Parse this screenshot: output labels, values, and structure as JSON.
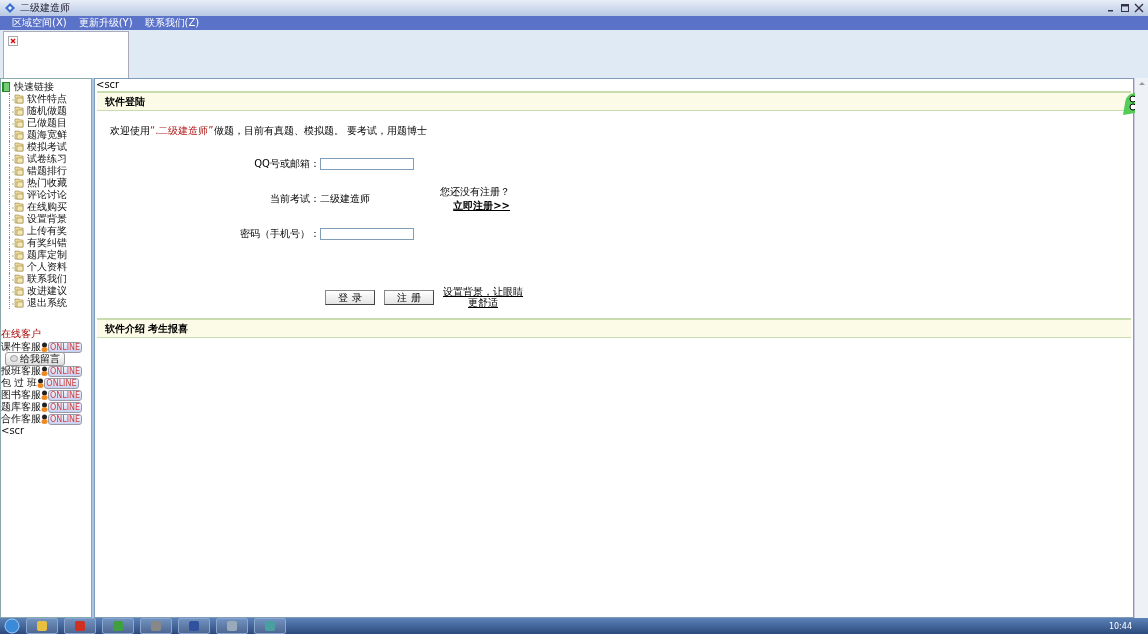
{
  "window": {
    "title": "二级建造师"
  },
  "menu": [
    "区域空间(X)",
    "更新升级(Y)",
    "联系我们(Z)"
  ],
  "frame_text_top": "<scr",
  "sidebar": {
    "root": "快速链接",
    "children": [
      {
        "label": "软件特点"
      },
      {
        "label": "随机做题"
      },
      {
        "label": "已做题目"
      },
      {
        "label": "题海宽鲜"
      },
      {
        "label": "模拟考试"
      },
      {
        "label": "试卷练习"
      },
      {
        "label": "错题排行"
      },
      {
        "label": "热门收藏"
      },
      {
        "label": "评论讨论"
      },
      {
        "label": "在线购买"
      },
      {
        "label": "设置背景"
      },
      {
        "label": "上传有奖"
      },
      {
        "label": "有奖纠错"
      },
      {
        "label": "题库定制"
      },
      {
        "label": "个人资料"
      },
      {
        "label": "联系我们"
      },
      {
        "label": "改进建议"
      },
      {
        "label": "退出系统"
      }
    ]
  },
  "support": {
    "title": "在线客户",
    "rows": [
      {
        "kind": "online",
        "label": "课件客服",
        "badge": "ONLINE"
      },
      {
        "kind": "message",
        "label": "给我留言"
      },
      {
        "kind": "online",
        "label": "报班客服",
        "badge": "ONLINE"
      },
      {
        "kind": "online",
        "label": "包 过 班",
        "badge": "ONLINE"
      },
      {
        "kind": "online",
        "label": "图书客服",
        "badge": "ONLINE"
      },
      {
        "kind": "online",
        "label": "题库客服",
        "badge": "ONLINE"
      },
      {
        "kind": "online",
        "label": "合作客服",
        "badge": "ONLINE"
      }
    ],
    "trailing": "<scr"
  },
  "login": {
    "heading": "软件登陆",
    "welcome": {
      "before": "欢迎使用",
      "highlight": "“.二级建造师”",
      "after": "做题，目前有真题、模拟题。 要考试，用题博士"
    },
    "fields": [
      {
        "kind": "input",
        "label": "QQ号或邮箱："
      },
      {
        "kind": "static",
        "label": "当前考试：",
        "value": "二级建造师"
      },
      {
        "kind": "input",
        "label": "密码（手机号）："
      }
    ],
    "register_hint": "您还没有注册？",
    "register_link": "立即注册>>",
    "buttons": [
      "登 录",
      "注 册"
    ],
    "background_link": "设置背景，让眼睛更舒适",
    "footer": "软件介绍 考生报喜"
  },
  "taskbar": {
    "clock": "10:44"
  }
}
